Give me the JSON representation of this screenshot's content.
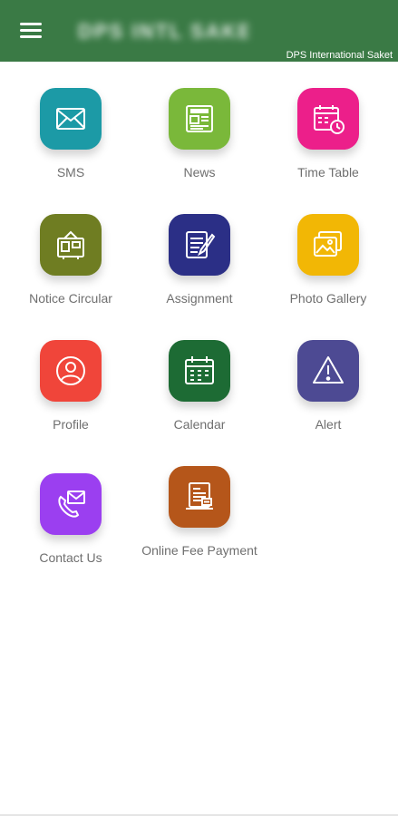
{
  "appbar": {
    "title": "DPS INTL SAKET",
    "subtitle": "DPS International Saket",
    "background": "#3a7a45",
    "menu_icon": "menu-icon"
  },
  "tiles": [
    {
      "label": "SMS",
      "icon": "envelope-icon",
      "color": "#1c9aa6"
    },
    {
      "label": "News",
      "icon": "newspaper-icon",
      "color": "#7ab83a"
    },
    {
      "label": "Time Table",
      "icon": "calendar-clock-icon",
      "color": "#ec1f8a"
    },
    {
      "label": "Notice Circular",
      "icon": "notice-board-icon",
      "color": "#6f7d22"
    },
    {
      "label": "Assignment",
      "icon": "document-pen-icon",
      "color": "#2b2f86"
    },
    {
      "label": "Photo Gallery",
      "icon": "image-gallery-icon",
      "color": "#f2b705"
    },
    {
      "label": "Profile",
      "icon": "user-icon",
      "color": "#f0453a"
    },
    {
      "label": "Calendar",
      "icon": "calendar-icon",
      "color": "#1d6b34"
    },
    {
      "label": "Alert",
      "icon": "warning-triangle-icon",
      "color": "#4d4a93"
    },
    {
      "label": "Contact Us",
      "icon": "phone-envelope-icon",
      "color": "#9b3ff0"
    },
    {
      "label": "Online Fee Payment",
      "icon": "invoice-icon",
      "color": "#b5561a"
    }
  ]
}
